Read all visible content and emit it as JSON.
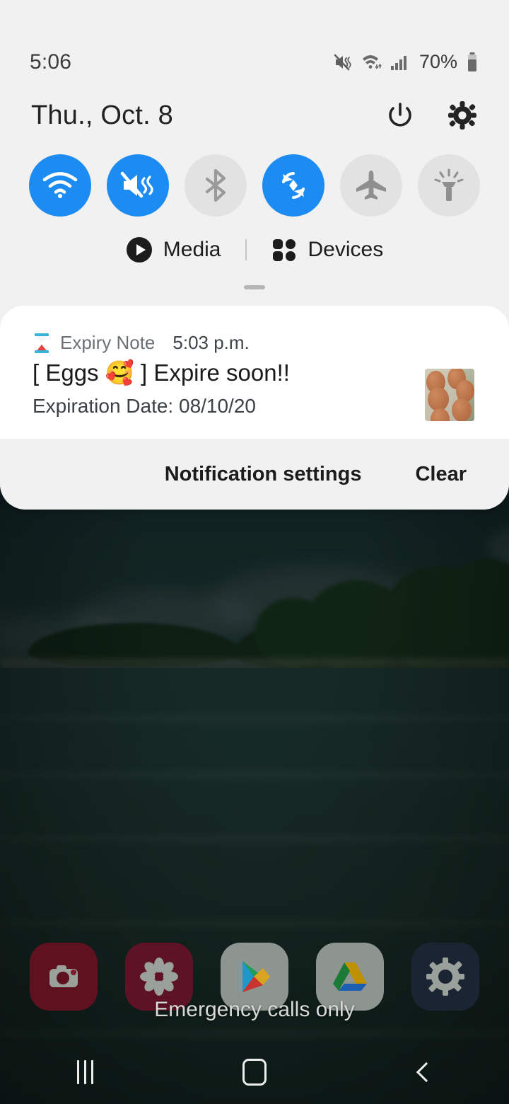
{
  "statusbar": {
    "clock": "5:06",
    "battery_percent": "70%",
    "icons": [
      "mute-vibrate-icon",
      "wifi-icon",
      "cellular-signal-icon",
      "battery-icon"
    ]
  },
  "shade": {
    "date": "Thu., Oct. 8",
    "power_icon": "power-icon",
    "settings_icon": "gear-icon",
    "toggles": [
      {
        "name": "wifi",
        "icon": "wifi-icon",
        "state": "on"
      },
      {
        "name": "sound-mode",
        "icon": "mute-vibrate-icon",
        "state": "on"
      },
      {
        "name": "bluetooth",
        "icon": "bluetooth-icon",
        "state": "off"
      },
      {
        "name": "auto-rotate",
        "icon": "sync-rotate-icon",
        "state": "on"
      },
      {
        "name": "airplane-mode",
        "icon": "airplane-icon",
        "state": "off"
      },
      {
        "name": "flashlight",
        "icon": "flashlight-icon",
        "state": "off"
      }
    ],
    "media_label": "Media",
    "media_icon": "play-circle-icon",
    "devices_label": "Devices",
    "devices_icon": "devices-grid-icon"
  },
  "notification": {
    "app_icon": "hourglass-icon",
    "app_name": "Expiry Note",
    "time": "5:03 p.m.",
    "title": "[ Eggs 🥰 ] Expire soon!!",
    "body": "Expiration Date: 08/10/20",
    "thumbnail_alt": "eggs-in-carton-photo",
    "settings_label": "Notification settings",
    "clear_label": "Clear"
  },
  "home": {
    "carrier_status": "Emergency calls only",
    "dock": [
      {
        "name": "camera",
        "icon": "camera-icon"
      },
      {
        "name": "gallery",
        "icon": "flower-gallery-icon"
      },
      {
        "name": "play-store",
        "icon": "play-store-icon"
      },
      {
        "name": "drive",
        "icon": "google-drive-icon"
      },
      {
        "name": "settings",
        "icon": "gear-icon"
      }
    ]
  },
  "navbar": {
    "recents": "recents-icon",
    "home": "home-icon",
    "back": "back-icon"
  },
  "colors": {
    "accent_blue": "#1d8cf2",
    "shade_bg": "#f1f1f1",
    "card_bg": "#ffffff",
    "toggle_off": "#e2e2e2"
  }
}
